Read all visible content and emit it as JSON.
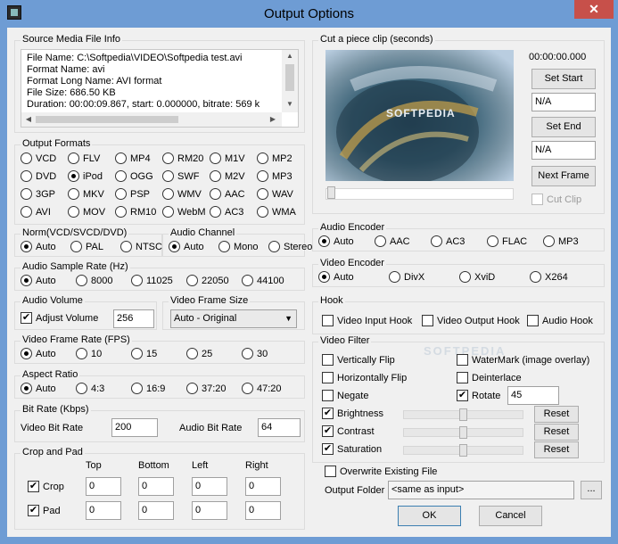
{
  "window": {
    "title": "Output Options",
    "close_glyph": "✕"
  },
  "source": {
    "title": "Source Media File Info",
    "lines": [
      "File Name: C:\\Softpedia\\VIDEO\\Softpedia test.avi",
      "Format Name: avi",
      "Format Long Name: AVI format",
      "File Size: 686.50 KB",
      "Duration: 00:00:09.867, start: 0.000000, bitrate: 569 k"
    ]
  },
  "output_formats": {
    "title": "Output Formats",
    "options": [
      "VCD",
      "FLV",
      "MP4",
      "RM20",
      "M1V",
      "MP2",
      "DVD",
      "iPod",
      "OGG",
      "SWF",
      "M2V",
      "MP3",
      "3GP",
      "MKV",
      "PSP",
      "WMV",
      "AAC",
      "WAV",
      "AVI",
      "MOV",
      "RM10",
      "WebM",
      "AC3",
      "WMA"
    ],
    "selected": "iPod"
  },
  "norm": {
    "title": "Norm(VCD/SVCD/DVD)",
    "options": [
      "Auto",
      "PAL",
      "NTSC"
    ],
    "selected": "Auto"
  },
  "audio_channel": {
    "title": "Audio Channel",
    "options": [
      "Auto",
      "Mono",
      "Stereo"
    ],
    "selected": "Auto"
  },
  "sample_rate": {
    "title": "Audio Sample Rate (Hz)",
    "options": [
      "Auto",
      "8000",
      "11025",
      "22050",
      "44100"
    ],
    "selected": "Auto"
  },
  "audio_volume": {
    "title": "Audio Volume",
    "adjust_label": "Adjust Volume",
    "adjust_checked": true,
    "value": "256"
  },
  "frame_size": {
    "title": "Video Frame Size",
    "value": "Auto - Original"
  },
  "frame_rate": {
    "title": "Video Frame Rate (FPS)",
    "options": [
      "Auto",
      "10",
      "15",
      "25",
      "30"
    ],
    "selected": "Auto"
  },
  "aspect": {
    "title": "Aspect Ratio",
    "options": [
      "Auto",
      "4:3",
      "16:9",
      "37:20",
      "47:20"
    ],
    "selected": "Auto"
  },
  "bitrate": {
    "title": "Bit Rate (Kbps)",
    "video_label": "Video Bit Rate",
    "video_value": "200",
    "audio_label": "Audio Bit Rate",
    "audio_value": "64"
  },
  "crop_pad": {
    "title": "Crop and Pad",
    "headers": [
      "Top",
      "Bottom",
      "Left",
      "Right"
    ],
    "crop_label": "Crop",
    "crop_checked": true,
    "crop_values": [
      "0",
      "0",
      "0",
      "0"
    ],
    "pad_label": "Pad",
    "pad_checked": true,
    "pad_values": [
      "0",
      "0",
      "0",
      "0"
    ]
  },
  "clip": {
    "title": "Cut a piece clip (seconds)",
    "time": "00:00:00.000",
    "set_start": "Set Start",
    "start_value": "N/A",
    "set_end": "Set End",
    "end_value": "N/A",
    "next_frame": "Next Frame",
    "cut_clip": "Cut Clip",
    "cut_clip_checked": false,
    "video_text": "SOFTPEDIA",
    "position": 0
  },
  "audio_encoder": {
    "title": "Audio Encoder",
    "options": [
      "Auto",
      "AAC",
      "AC3",
      "FLAC",
      "MP3"
    ],
    "selected": "Auto"
  },
  "video_encoder": {
    "title": "Video Encoder",
    "options": [
      "Auto",
      "DivX",
      "XviD",
      "X264"
    ],
    "selected": "Auto"
  },
  "hook": {
    "title": "Hook",
    "video_input": "Video Input Hook",
    "video_output": "Video Output Hook",
    "audio": "Audio Hook"
  },
  "filter": {
    "title": "Video Filter",
    "vflip": "Vertically Flip",
    "hflip": "Horizontally Flip",
    "negate": "Negate",
    "watermark": "WaterMark (image overlay)",
    "deinterlace": "Deinterlace",
    "rotate": "Rotate",
    "rotate_checked": true,
    "rotate_value": "45",
    "brightness": "Brightness",
    "contrast": "Contrast",
    "saturation": "Saturation",
    "reset": "Reset",
    "brightness_level": 0.5,
    "contrast_level": 0.5,
    "saturation_level": 0.5,
    "watermark_text": "SOFTPEDIA"
  },
  "overwrite": {
    "label": "Overwrite Existing File",
    "checked": false
  },
  "output_folder": {
    "label": "Output Folder",
    "value": "<same as input>",
    "browse": "..."
  },
  "actions": {
    "ok": "OK",
    "cancel": "Cancel"
  },
  "colors": {
    "titlebar": "#6e9cd4",
    "close": "#c7504a",
    "client": "#f0f0f0"
  }
}
